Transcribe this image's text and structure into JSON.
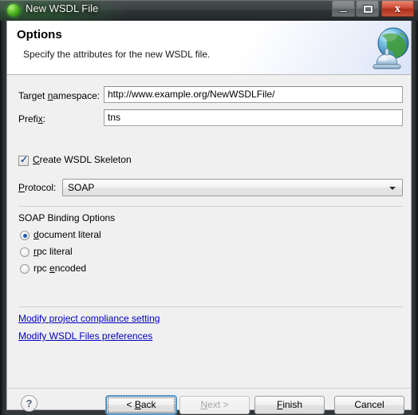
{
  "window": {
    "title": "New WSDL File",
    "icon": "green-sphere-icon",
    "caption_buttons": {
      "minimize": "minimize-icon",
      "maximize": "maximize-icon",
      "close_glyph": "x"
    }
  },
  "header": {
    "title": "Options",
    "description": "Specify the attributes for the new WSDL file.",
    "icon": "wsdl-globe-service-icon"
  },
  "form": {
    "target_namespace": {
      "label_pre": "Target ",
      "label_mnemonic": "n",
      "label_post": "amespace:",
      "value": "http://www.example.org/NewWSDLFile/"
    },
    "prefix": {
      "label_pre": "Prefi",
      "label_mnemonic": "x",
      "label_post": ":",
      "value": "tns"
    },
    "create_skeleton": {
      "label_pre": "",
      "label_mnemonic": "C",
      "label_post": "reate WSDL Skeleton",
      "checked": "✓"
    },
    "protocol": {
      "label_pre": "",
      "label_mnemonic": "P",
      "label_post": "rotocol:",
      "selected": "SOAP",
      "options": [
        "SOAP"
      ]
    }
  },
  "binding": {
    "group_label": "SOAP Binding Options",
    "options": [
      {
        "pre": "",
        "mnemonic": "d",
        "post": "ocument literal",
        "selected": true
      },
      {
        "pre": "",
        "mnemonic": "r",
        "post": "pc literal",
        "selected": false
      },
      {
        "pre": "rpc ",
        "mnemonic": "e",
        "post": "ncoded",
        "selected": false
      }
    ]
  },
  "links": [
    {
      "text": "Modify project compliance setting"
    },
    {
      "text": "Modify WSDL Files preferences"
    }
  ],
  "footer": {
    "help": "?",
    "buttons": [
      {
        "label": "< Back",
        "pre": "< ",
        "mnemonic": "B",
        "post": "ack"
      },
      {
        "label": "Next >",
        "pre": "",
        "mnemonic": "N",
        "post": "ext >"
      },
      {
        "label": "Finish",
        "pre": "",
        "mnemonic": "F",
        "post": "inish"
      },
      {
        "label": "Cancel",
        "pre": "Cancel",
        "mnemonic": "",
        "post": ""
      }
    ]
  },
  "colors": {
    "link": "#0000c0",
    "accent": "#2b5797",
    "close_button": "#cf4b35",
    "dialog_bg": "#f0f0f0"
  }
}
